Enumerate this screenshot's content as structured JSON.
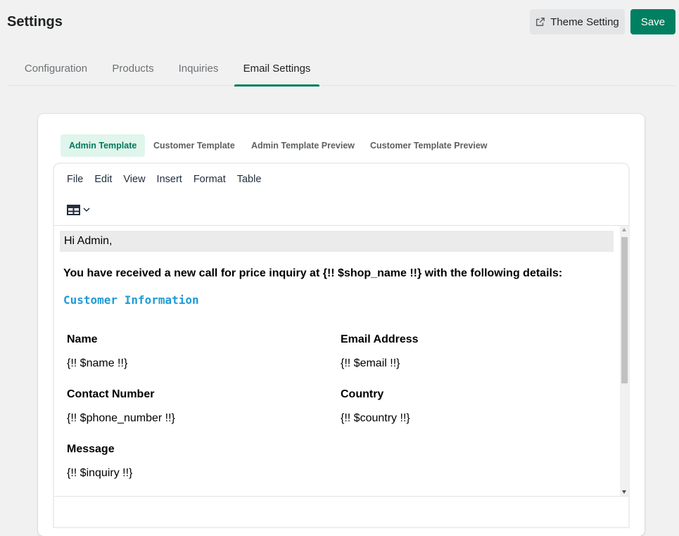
{
  "header": {
    "title": "Settings",
    "theme_button": "Theme Setting",
    "save_button": "Save"
  },
  "tabs": [
    {
      "label": "Configuration",
      "active": false
    },
    {
      "label": "Products",
      "active": false
    },
    {
      "label": "Inquiries",
      "active": false
    },
    {
      "label": "Email Settings",
      "active": true
    }
  ],
  "subtabs": [
    {
      "label": "Admin Template",
      "active": true
    },
    {
      "label": "Customer Template",
      "active": false
    },
    {
      "label": "Admin Template Preview",
      "active": false
    },
    {
      "label": "Customer Template Preview",
      "active": false
    }
  ],
  "editor": {
    "menu": [
      "File",
      "Edit",
      "View",
      "Insert",
      "Format",
      "Table"
    ],
    "toolbar_icon": "table-icon",
    "greeting": "Hi Admin,",
    "intro": "You have received a new call for price inquiry at {!! $shop_name !!} with the following details:",
    "section_title": "Customer Information",
    "fields": {
      "name_label": "Name",
      "name_value": "{!! $name !!}",
      "email_label": "Email Address",
      "email_value": "{!! $email !!}",
      "phone_label": "Contact Number",
      "phone_value": "{!! $phone_number !!}",
      "country_label": "Country",
      "country_value": "{!! $country !!}",
      "message_label": "Message",
      "message_value": "{!! $inquiry !!}"
    }
  },
  "colors": {
    "accent": "#008060",
    "section_title": "#1f9ad6"
  }
}
